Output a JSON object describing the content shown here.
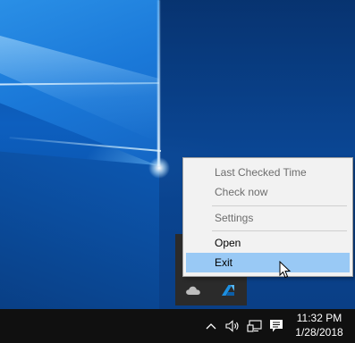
{
  "context_menu": {
    "items": [
      {
        "label": "Last Checked Time",
        "state": "disabled"
      },
      {
        "label": "Check now",
        "state": "disabled"
      },
      {
        "label": "Settings",
        "state": "disabled"
      },
      {
        "label": "Open",
        "state": "enabled"
      },
      {
        "label": "Exit",
        "state": "highlighted"
      }
    ],
    "highlight_color": "#99c9f5",
    "background_color": "#f2f2f2"
  },
  "tray_overflow": {
    "icons": [
      "onedrive-cloud-icon",
      "autodesk-icon"
    ]
  },
  "taskbar": {
    "tray_icons": [
      "chevron-up-icon",
      "volume-icon",
      "network-icon",
      "action-center-icon"
    ],
    "clock": {
      "time": "11:32 PM",
      "date": "1/28/2018"
    }
  },
  "colors": {
    "taskbar": "#101010",
    "tray_flyout": "#2b2b2b",
    "autodesk_blue": "#1d8fe0"
  }
}
